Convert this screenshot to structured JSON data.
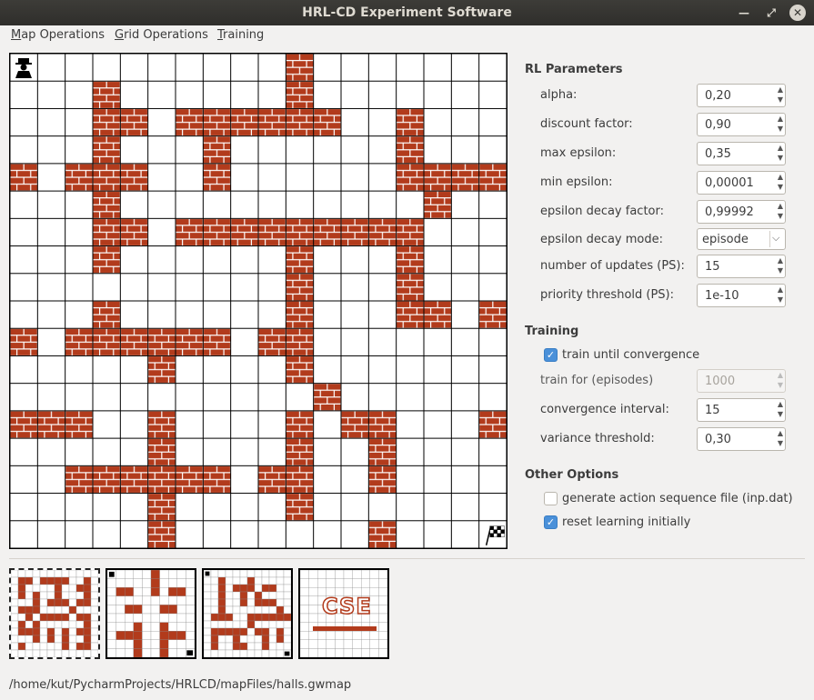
{
  "window": {
    "title": "HRL-CD Experiment Software"
  },
  "menu": [
    {
      "mnemonic": "M",
      "rest": "ap Operations"
    },
    {
      "mnemonic": "G",
      "rest": "rid Operations"
    },
    {
      "mnemonic": "T",
      "rest": "raining"
    }
  ],
  "rl_parameters": {
    "title": "RL Parameters",
    "alpha": {
      "label": "alpha:",
      "value": "0,20"
    },
    "discount": {
      "label": "discount factor:",
      "value": "0,90"
    },
    "max_eps": {
      "label": "max epsilon:",
      "value": "0,35"
    },
    "min_eps": {
      "label": "min epsilon:",
      "value": "0,00001"
    },
    "eps_decay": {
      "label": "epsilon decay factor:",
      "value": "0,99992"
    },
    "eps_mode": {
      "label": "epsilon decay mode:",
      "value": "episode"
    },
    "num_updates": {
      "label": "number of updates (PS):",
      "value": "15"
    },
    "priority": {
      "label": "priority threshold (PS):",
      "value": "1e-10"
    }
  },
  "training": {
    "title": "Training",
    "until_conv": {
      "label": "train until convergence",
      "checked": true
    },
    "train_for": {
      "label": "train for (episodes)",
      "value": "1000"
    },
    "conv_interval": {
      "label": "convergence interval:",
      "value": "15"
    },
    "variance": {
      "label": "variance threshold:",
      "value": "0,30"
    }
  },
  "other": {
    "title": "Other Options",
    "gen_seq": {
      "label": "generate action sequence file (inp.dat)",
      "checked": false
    },
    "reset": {
      "label": "reset learning initially",
      "checked": true
    }
  },
  "thumb_labels": [
    "CSE"
  ],
  "status_path": "/home/kut/PycharmProjects/HRLCD/mapFiles/halls.gwmap",
  "colors": {
    "wall": "#b23b1c",
    "mortar": "#ffffff",
    "check_accent": "#4a90d9"
  },
  "grid": {
    "rows": 18,
    "cols": 18,
    "agent": [
      0,
      0
    ],
    "goal": [
      17,
      17
    ],
    "walls": [
      "..........#.......",
      "...#......#.......",
      "...##.######..#...",
      "...#...#......#...",
      "#.###..#......####",
      "...#...........#..",
      "...##.#########...",
      "...#......#...#...",
      "..........#...#...",
      "...#......#...##.##",
      "#.######.##.......",
      ".....#....#.......",
      "...........#......",
      "###..#....#.##...#",
      ".....#....#..#....",
      "..######.##..#....",
      ".....#....#.......",
      ".....#.......#...."
    ]
  }
}
